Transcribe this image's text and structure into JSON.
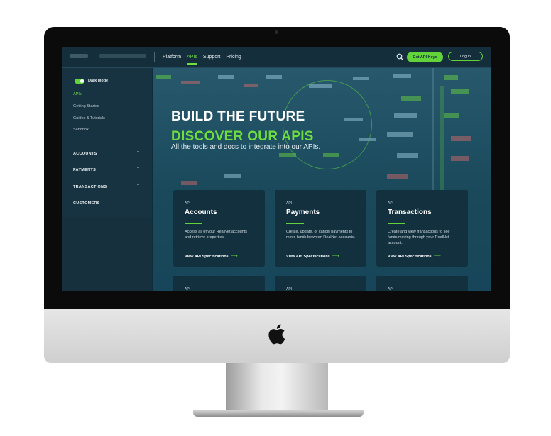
{
  "topbar": {
    "nav": [
      "Platform",
      "APIs",
      "Support",
      "Pricing"
    ],
    "active_nav": "APIs",
    "get_keys_label": "Get API Keys",
    "login_label": "Log in"
  },
  "sidebar": {
    "dark_mode_label": "Dark Mode",
    "dark_mode_on": true,
    "links": [
      "APIs",
      "Getting Started",
      "Guides & Tutorials",
      "Sandbox"
    ],
    "groups": [
      "ACCOUNTS",
      "PAYMENTS",
      "TRANSACTIONS",
      "CUSTOMERS"
    ]
  },
  "hero": {
    "title_line1": "BUILD THE FUTURE",
    "title_line2": "DISCOVER OUR APIS",
    "subtitle": "All the tools and docs to integrate into our APIs."
  },
  "cards": [
    {
      "tag": "API",
      "title": "Accounts",
      "description": "Access all of your RealNet accounts and retrieve properties.",
      "link": "View API Specifications"
    },
    {
      "tag": "API",
      "title": "Payments",
      "description": "Create, update, or cancel payments to move funds between RealNet accounts.",
      "link": "View API Specifications"
    },
    {
      "tag": "API",
      "title": "Transactions",
      "description": "Create and view transactions to see funds moving through your RealNet account.",
      "link": "View API Specifications"
    }
  ],
  "cards_row2_tags": [
    "API",
    "API",
    "API"
  ],
  "colors": {
    "accent": "#63d33a",
    "background": "#0f2c3a",
    "card": "#13303e"
  }
}
